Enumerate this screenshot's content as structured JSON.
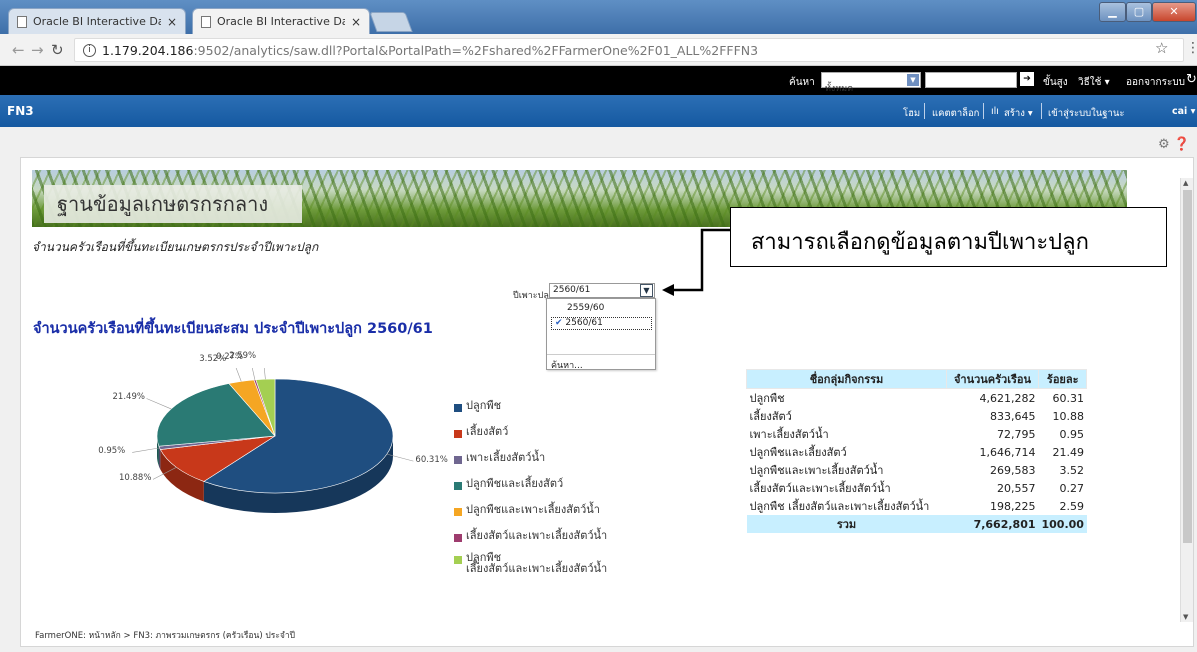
{
  "browser": {
    "tabs": [
      {
        "title": "Oracle BI Interactive Dash"
      },
      {
        "title": "Oracle BI Interactive Dasl"
      }
    ],
    "close_glyph": "×",
    "url_host": "1.179.204.186",
    "url_path": ":9502/analytics/saw.dll?Portal&PortalPath=%2Fshared%2FFarmerOne%2F01_ALL%2FFFN3"
  },
  "header": {
    "search_label": "ค้นหา",
    "scope_value": "ทั้งหมด",
    "advanced": "ขั้นสูง",
    "help": "วิธีใช้ ▾",
    "logout": "ออกจากระบบ"
  },
  "dashbar": {
    "title": "FN3",
    "home": "โฮม",
    "catalog": "แคตตาล็อก",
    "create": "สร้าง ▾",
    "signed_in": "เข้าสู่ระบบในฐานะ",
    "user": "cai ▾"
  },
  "banner": {
    "title": "ฐานข้อมูลเกษตรกรกลาง"
  },
  "subtitle": "จำนวนครัวเรือนที่ขึ้นทะเบียนเกษตรกรประจำปีเพาะปลูก",
  "callout": "สามารถเลือกดูข้อมูลตามปีเพาะปลูก",
  "prompt": {
    "label": "ปีเพาะปลูก",
    "selected": "2560/61",
    "options": [
      "2559/60",
      "2560/61"
    ],
    "more": "ค้นหา..."
  },
  "section_title": "จำนวนครัวเรือนที่ขึ้นทะเบียนสะสม ประจำปีเพาะปลูก 2560/61",
  "chart_data": {
    "type": "pie",
    "categories": [
      "ปลูกพืช",
      "เลี้ยงสัตว์",
      "เพาะเลี้ยงสัตว์น้ำ",
      "ปลูกพืชและเลี้ยงสัตว์",
      "ปลูกพืชและเพาะเลี้ยงสัตว์น้ำ",
      "เลี้ยงสัตว์และเพาะเลี้ยงสัตว์น้ำ",
      "ปลูกพืช เลี้ยงสัตว์และเพาะเลี้ยงสัตว์น้ำ"
    ],
    "legend_labels": [
      "ปลูกพืช",
      "เลี้ยงสัตว์",
      "เพาะเลี้ยงสัตว์น้ำ",
      "ปลูกพืชและเลี้ยงสัตว์",
      "ปลูกพืชและเพาะเลี้ยงสัตว์น้ำ",
      "เลี้ยงสัตว์และเพาะเลี้ยงสัตว์น้ำ",
      "ปลูกพืช\nเลี้ยงสัตว์และเพาะเลี้ยงสัตว์น้ำ"
    ],
    "values": [
      60.31,
      10.88,
      0.95,
      21.49,
      3.52,
      0.27,
      2.59
    ],
    "data_labels": [
      "60.31%",
      "10.88%",
      "0.95%",
      "21.49%",
      "3.52%",
      "0.27%",
      "2.59%"
    ],
    "colors": [
      "#1f4e80",
      "#c8381a",
      "#6f6690",
      "#2a7a74",
      "#f5a623",
      "#9e3c6e",
      "#a4cf52"
    ],
    "legend_position": "right"
  },
  "table": {
    "headers": [
      "ชื่อกลุ่มกิจกรรม",
      "จำนวนครัวเรือน",
      "ร้อยละ"
    ],
    "rows": [
      [
        "ปลูกพืช",
        "4,621,282",
        "60.31"
      ],
      [
        "เลี้ยงสัตว์",
        "833,645",
        "10.88"
      ],
      [
        "เพาะเลี้ยงสัตว์น้ำ",
        "72,795",
        "0.95"
      ],
      [
        "ปลูกพืชและเลี้ยงสัตว์",
        "1,646,714",
        "21.49"
      ],
      [
        "ปลูกพืชและเพาะเลี้ยงสัตว์น้ำ",
        "269,583",
        "3.52"
      ],
      [
        "เลี้ยงสัตว์และเพาะเลี้ยงสัตว์น้ำ",
        "20,557",
        "0.27"
      ],
      [
        "ปลูกพืช เลี้ยงสัตว์และเพาะเลี้ยงสัตว์น้ำ",
        "198,225",
        "2.59"
      ]
    ],
    "total": [
      "รวม",
      "7,662,801",
      "100.00"
    ]
  },
  "breadcrumb": "FarmerONE: หน้าหลัก  >  FN3: ภาพรวมเกษตรกร (ครัวเรือน) ประจำปี"
}
